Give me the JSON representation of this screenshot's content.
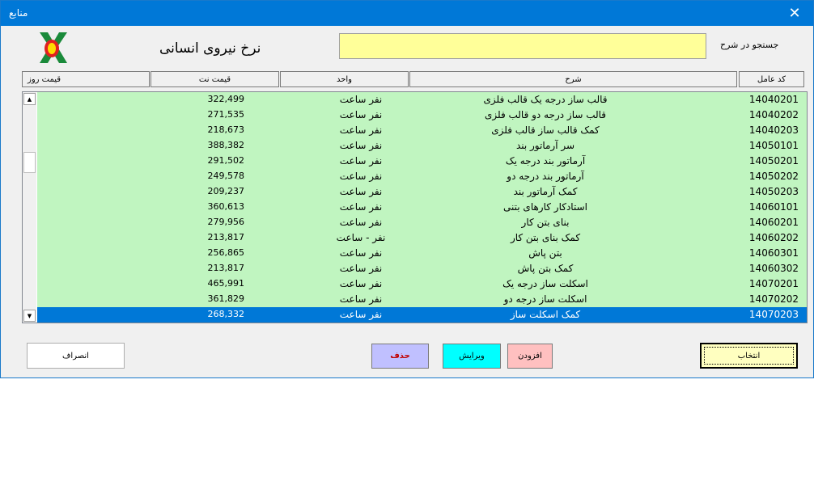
{
  "window": {
    "title": "منابع",
    "close_glyph": "✕"
  },
  "header": {
    "title": "نرخ نیروی انسانی"
  },
  "search": {
    "label": "جستجو در شرح",
    "value": ""
  },
  "columns": [
    "کد عامل",
    "شرح",
    "واحد",
    "قیمت نت",
    "قیمت روز"
  ],
  "rows": [
    {
      "code": "14040201",
      "desc": "قالب ساز درجه یک قالب فلزی",
      "unit": "نفر ساعت",
      "price": "322,499"
    },
    {
      "code": "14040202",
      "desc": "قالب ساز درجه دو قالب فلزی",
      "unit": "نفر ساعت",
      "price": "271,535"
    },
    {
      "code": "14040203",
      "desc": "کمک قالب ساز قالب فلزی",
      "unit": "نفر ساعت",
      "price": "218,673"
    },
    {
      "code": "14050101",
      "desc": "سر آرماتور بند",
      "unit": "نفر ساعت",
      "price": "388,382"
    },
    {
      "code": "14050201",
      "desc": "آرماتور بند درجه یک",
      "unit": "نفر ساعت",
      "price": "291,502"
    },
    {
      "code": "14050202",
      "desc": "آرماتور بند درجه دو",
      "unit": "نفر ساعت",
      "price": "249,578"
    },
    {
      "code": "14050203",
      "desc": "کمک آرماتور بند",
      "unit": "نفر ساعت",
      "price": "209,237"
    },
    {
      "code": "14060101",
      "desc": "استادکار کارهای بتنی",
      "unit": "نفر ساعت",
      "price": "360,613"
    },
    {
      "code": "14060201",
      "desc": "بنای بتن کار",
      "unit": "نفر ساعت",
      "price": "279,956"
    },
    {
      "code": "14060202",
      "desc": "کمک بنای بتن کار",
      "unit": "نفر - ساعت",
      "price": "213,817"
    },
    {
      "code": "14060301",
      "desc": "بتن پاش",
      "unit": "نفر ساعت",
      "price": "256,865"
    },
    {
      "code": "14060302",
      "desc": "کمک بتن پاش",
      "unit": "نفر ساعت",
      "price": "213,817"
    },
    {
      "code": "14070201",
      "desc": "اسکلت ساز درجه یک",
      "unit": "نفر ساعت",
      "price": "465,991"
    },
    {
      "code": "14070202",
      "desc": "اسکلت ساز درجه دو",
      "unit": "نفر ساعت",
      "price": "361,829"
    },
    {
      "code": "14070203",
      "desc": "کمک اسکلت ساز",
      "unit": "نفر ساعت",
      "price": "268,332"
    }
  ],
  "buttons": {
    "cancel": "انصراف",
    "delete": "حذف",
    "edit": "ویرایش",
    "add": "افزودن",
    "select": "انتخاب"
  },
  "colors": {
    "titlebar": "#0078d7",
    "row_bg": "#c0f5c0",
    "selected_bg": "#0078d7",
    "search_bg": "#ffff99"
  }
}
